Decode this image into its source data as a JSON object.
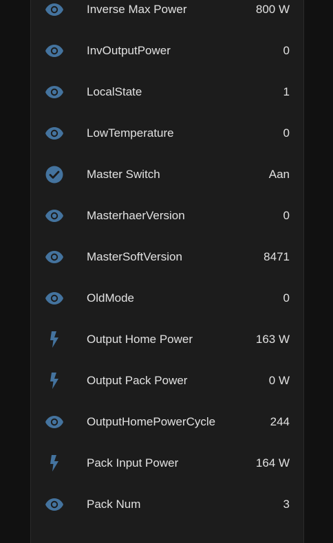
{
  "colors": {
    "page_bg": "#111111",
    "card_bg": "#1c1c1c",
    "text": "#e1e1e1",
    "icon": "#44739e"
  },
  "entities": [
    {
      "icon": "eye-icon",
      "label": "Inverse Max Power",
      "value": "800 W"
    },
    {
      "icon": "eye-icon",
      "label": "InvOutputPower",
      "value": "0"
    },
    {
      "icon": "eye-icon",
      "label": "LocalState",
      "value": "1"
    },
    {
      "icon": "eye-icon",
      "label": "LowTemperature",
      "value": "0"
    },
    {
      "icon": "check-circle-icon",
      "label": "Master Switch",
      "value": "Aan"
    },
    {
      "icon": "eye-icon",
      "label": "MasterhaerVersion",
      "value": "0"
    },
    {
      "icon": "eye-icon",
      "label": "MasterSoftVersion",
      "value": "8471"
    },
    {
      "icon": "eye-icon",
      "label": "OldMode",
      "value": "0"
    },
    {
      "icon": "flash-icon",
      "label": "Output Home Power",
      "value": "163 W"
    },
    {
      "icon": "flash-icon",
      "label": "Output Pack Power",
      "value": "0 W"
    },
    {
      "icon": "eye-icon",
      "label": "OutputHomePowerCycle",
      "value": "244"
    },
    {
      "icon": "flash-icon",
      "label": "Pack Input Power",
      "value": "164 W"
    },
    {
      "icon": "eye-icon",
      "label": "Pack Num",
      "value": "3"
    }
  ]
}
